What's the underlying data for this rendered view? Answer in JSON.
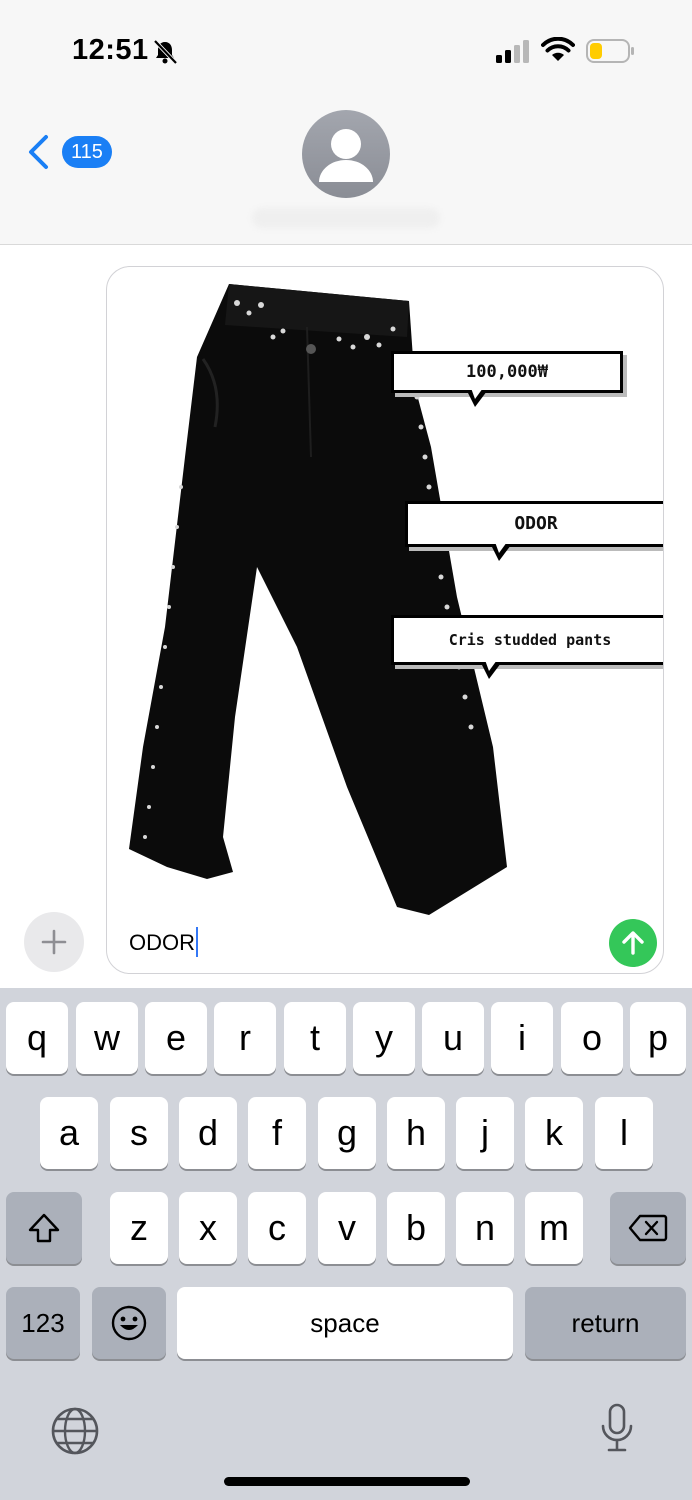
{
  "status_bar": {
    "time": "12:51"
  },
  "header": {
    "back_count": "115"
  },
  "compose": {
    "text": "ODOR",
    "image": {
      "subject": "black studded pants",
      "tags": [
        "100,000₩",
        "ODOR",
        "Cris studded pants"
      ]
    }
  },
  "keyboard": {
    "row1": [
      "q",
      "w",
      "e",
      "r",
      "t",
      "y",
      "u",
      "i",
      "o",
      "p"
    ],
    "row2": [
      "a",
      "s",
      "d",
      "f",
      "g",
      "h",
      "j",
      "k",
      "l"
    ],
    "row3": [
      "z",
      "x",
      "c",
      "v",
      "b",
      "n",
      "m"
    ],
    "numbers_label": "123",
    "space_label": "space",
    "return_label": "return"
  },
  "colors": {
    "accent": "#1a7ff5",
    "send": "#34c759",
    "keyboard_bg": "#d1d4db"
  },
  "icons": [
    "bell-slash-icon",
    "signal-icon",
    "wifi-icon",
    "battery-icon",
    "back-chevron-icon",
    "person-icon",
    "plus-icon",
    "arrow-up-icon",
    "shift-icon",
    "delete-icon",
    "emoji-icon",
    "globe-icon",
    "microphone-icon"
  ]
}
